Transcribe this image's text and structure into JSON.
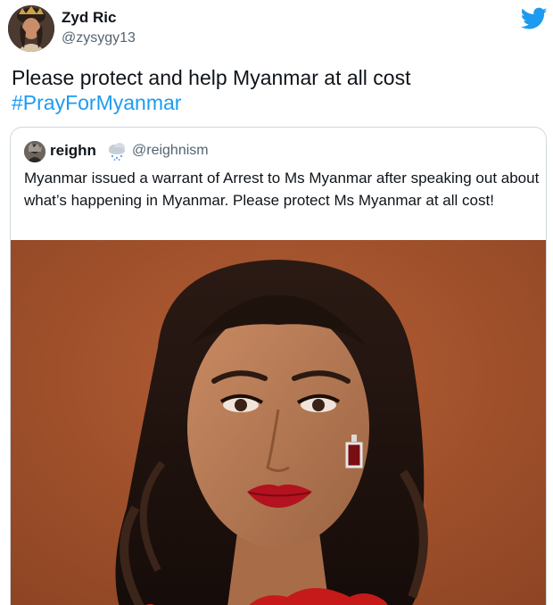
{
  "tweet": {
    "author": {
      "display_name": "Zyd Ric",
      "handle": "@zysygy13",
      "avatar_icon": "profile-photo"
    },
    "platform_icon": "twitter-bird-icon",
    "text": "Please protect and help Myanmar at all cost",
    "hashtag": "#PrayForMyanmar",
    "colors": {
      "link": "#1d9bf0",
      "secondary_text": "#536471",
      "border": "#cfd9de"
    }
  },
  "quoted_tweet": {
    "author": {
      "display_name": "reighn",
      "name_emoji": "cloud-rain-emoji",
      "handle": "@reighnism",
      "avatar_icon": "profile-photo"
    },
    "text": "Myanmar issued a warrant of Arrest to Ms Myanmar after speaking out about what’s happening in Myanmar. Please protect Ms Myanmar at all cost!",
    "media": {
      "type": "photo",
      "background_color": "#a3502a"
    }
  }
}
